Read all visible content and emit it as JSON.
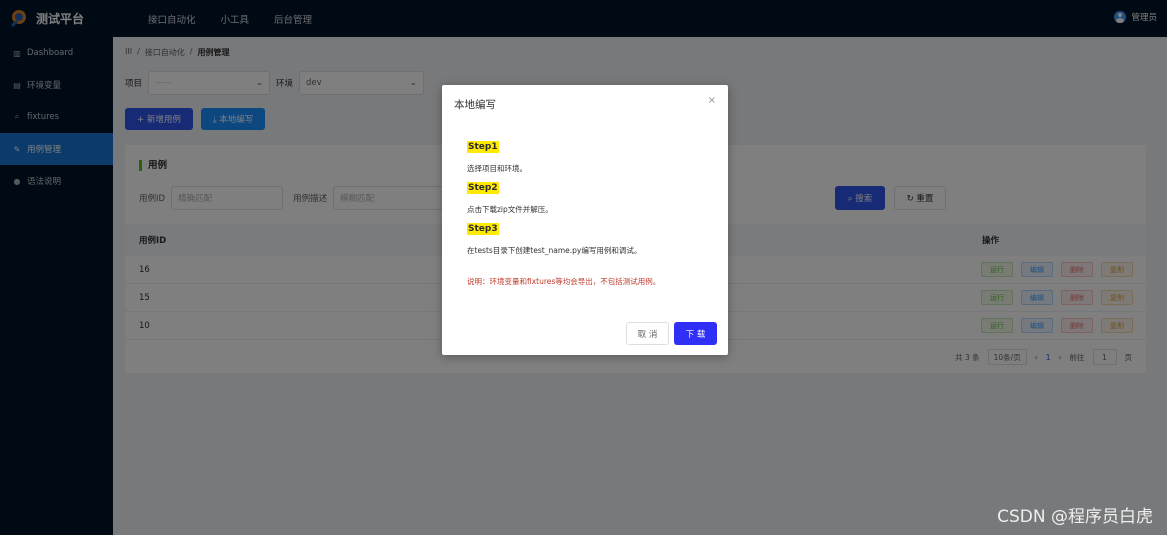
{
  "app": {
    "title": "测试平台"
  },
  "topnav": [
    "接口自动化",
    "小工具",
    "后台管理"
  ],
  "user": {
    "name": "管理员"
  },
  "sidebar": [
    {
      "label": "Dashboard",
      "icon": "bar-chart-icon"
    },
    {
      "label": "环境变量",
      "icon": "document-icon"
    },
    {
      "label": "fixtures",
      "icon": "magnifier-icon"
    },
    {
      "label": "用例管理",
      "icon": "edit-icon",
      "active": true
    },
    {
      "label": "语法说明",
      "icon": "location-pin-icon"
    }
  ],
  "breadcrumb": {
    "home": "III",
    "sep": "/",
    "parent": "接口自动化",
    "current": "用例管理"
  },
  "filters": {
    "project_label": "项目",
    "env_label": "环境",
    "env_value": "dev"
  },
  "buttons": {
    "new_case": "+ 新增用例",
    "local_write": "⤓ 本地编写"
  },
  "card": {
    "title": "用例",
    "case_id_label": "用例ID",
    "case_id_placeholder": "精确匹配",
    "case_desc_label": "用例描述",
    "case_desc_placeholder": "模糊匹配",
    "search_btn": "⌕ 搜索",
    "reset_btn": "↻ 重置"
  },
  "table": {
    "headers": {
      "id": "用例ID",
      "ops": "操作"
    },
    "rows": [
      {
        "id": "16"
      },
      {
        "id": "15"
      },
      {
        "id": "10"
      }
    ],
    "ops": {
      "run": "运行",
      "edit": "编辑",
      "delete": "删除",
      "copy": "复制"
    }
  },
  "pager": {
    "total": "共 3 条",
    "page_size": "10条/页",
    "prev": "‹",
    "page": "1",
    "next": "›",
    "goto": "前往",
    "goto_value": "1",
    "page_unit": "页"
  },
  "modal": {
    "title": "本地编写",
    "close": "×",
    "step1": "Step1",
    "step1_desc": "选择项目和环境。",
    "step2": "Step2",
    "step2_desc": "点击下载zip文件并解压。",
    "step3": "Step3",
    "step3_desc": "在tests目录下创建test_name.py编写用例和调试。",
    "note": "说明：环境变量和fixtures等均会导出，不包括测试用例。",
    "cancel": "取 消",
    "download": "下 载"
  },
  "watermark": "CSDN @程序员白虎",
  "colors": {
    "nav_bg": "#001529",
    "active": "#1677d6",
    "primary": "#2f54eb",
    "step_highlight": "#ffea00",
    "note": "#c0392b"
  }
}
